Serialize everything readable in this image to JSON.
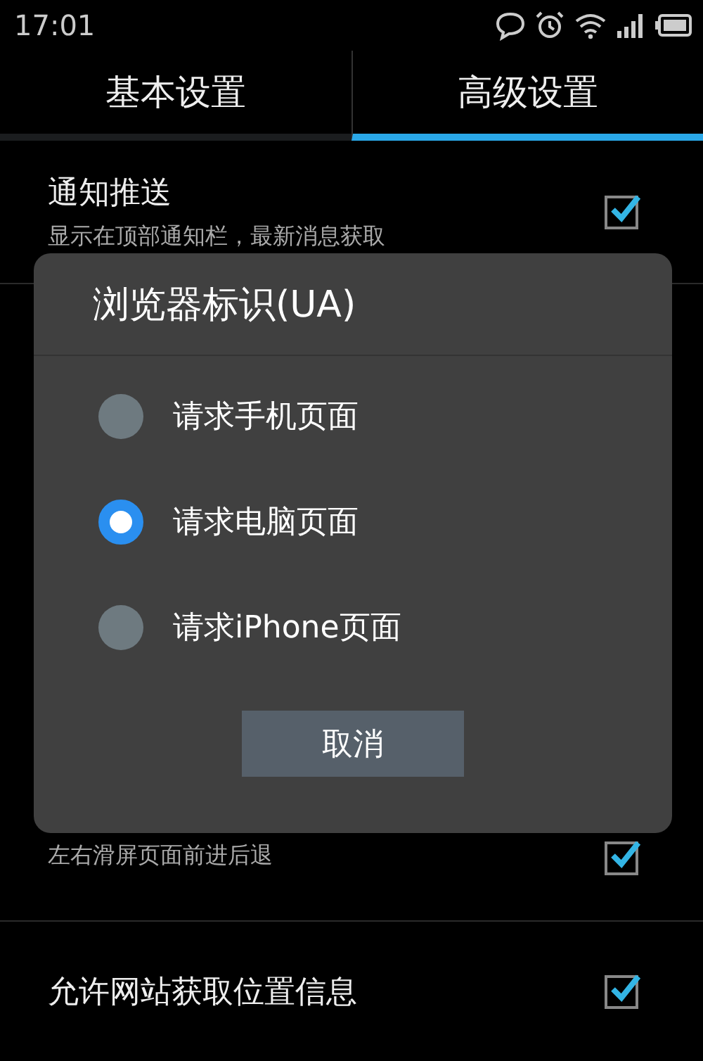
{
  "status_bar": {
    "time": "17:01"
  },
  "tabs": [
    {
      "label": "基本设置",
      "selected": false
    },
    {
      "label": "高级设置",
      "selected": true
    }
  ],
  "settings": [
    {
      "kind": "check",
      "title": "通知推送",
      "subtitle": "显示在顶部通知栏，最新消息获取",
      "checked": true
    },
    {
      "kind": "check",
      "subtitle": "左右滑屏页面前进后退",
      "checked": true
    },
    {
      "kind": "check",
      "title": "允许网站获取位置信息",
      "checked": true
    }
  ],
  "dialog": {
    "title": "浏览器标识(UA)",
    "options": [
      {
        "label": "请求手机页面",
        "selected": false
      },
      {
        "label": "请求电脑页面",
        "selected": true
      },
      {
        "label": "请求iPhone页面",
        "selected": false
      }
    ],
    "button": "取消"
  }
}
